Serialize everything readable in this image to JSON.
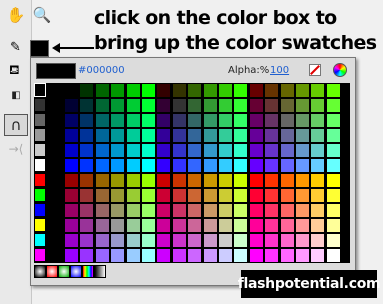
{
  "callout": {
    "line1": "click on the color box to",
    "line2": "bring up the color swatches"
  },
  "swatch_panel": {
    "hex_value": "#000000",
    "alpha_label": "Alpha:%",
    "alpha_value": "100",
    "selected_color": "#000000"
  },
  "logo": {
    "text": "flashpotential.com"
  },
  "icons": {
    "hand": "hand-icon",
    "zoom": "zoom-icon",
    "pencil": "pencil-icon",
    "bucket": "paint-bucket-icon",
    "swap": "swap-colors-icon",
    "magnet": "snap-icon"
  }
}
